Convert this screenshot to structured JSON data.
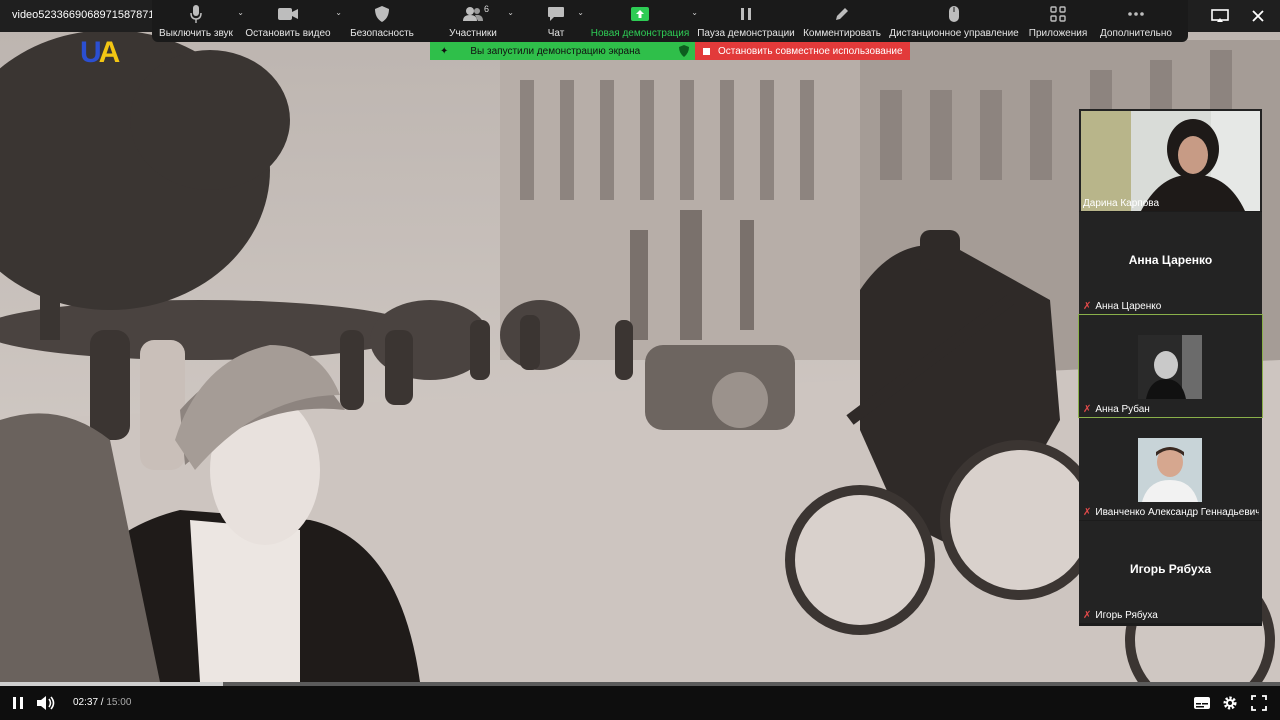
{
  "window": {
    "filename": "video5233669068971587871"
  },
  "toolbar": {
    "items": [
      {
        "label": "Выключить звук",
        "icon": "microphone-icon"
      },
      {
        "label": "Остановить видео",
        "icon": "video-camera-icon"
      },
      {
        "label": "Безопасность",
        "icon": "shield-icon"
      },
      {
        "label": "Участники",
        "icon": "participants-icon",
        "badge": "6"
      },
      {
        "label": "Чат",
        "icon": "chat-icon"
      },
      {
        "label": "Новая демонстрация",
        "icon": "share-screen-icon"
      },
      {
        "label": "Пауза демонстрации",
        "icon": "pause-icon"
      },
      {
        "label": "Комментировать",
        "icon": "pencil-icon"
      },
      {
        "label": "Дистанционное управление",
        "icon": "mouse-icon"
      },
      {
        "label": "Приложения",
        "icon": "apps-icon"
      },
      {
        "label": "Дополнительно",
        "icon": "more-icon"
      }
    ]
  },
  "share": {
    "started": "Вы запустили демонстрацию экрана",
    "stop": "Остановить совместное использование"
  },
  "logo": {
    "u": "U",
    "a": "A"
  },
  "participants": [
    {
      "name": "Дарина Карпова",
      "type": "video"
    },
    {
      "name": "Анна Царенко",
      "big": "Анна Царенко",
      "type": "name"
    },
    {
      "name": "Анна Рубан",
      "type": "photo"
    },
    {
      "name": "Иванченко Александр Геннадьевич",
      "type": "photo"
    },
    {
      "name": "Игорь Рябуха",
      "big": "Игорь Рябуха",
      "type": "name"
    }
  ],
  "player": {
    "current": "02:37",
    "separator": " / ",
    "total": "15:00",
    "progress": 0.174
  },
  "colors": {
    "green": "#2fbf4a",
    "red": "#e23a3a",
    "accent_green_text": "#2ecc55"
  }
}
